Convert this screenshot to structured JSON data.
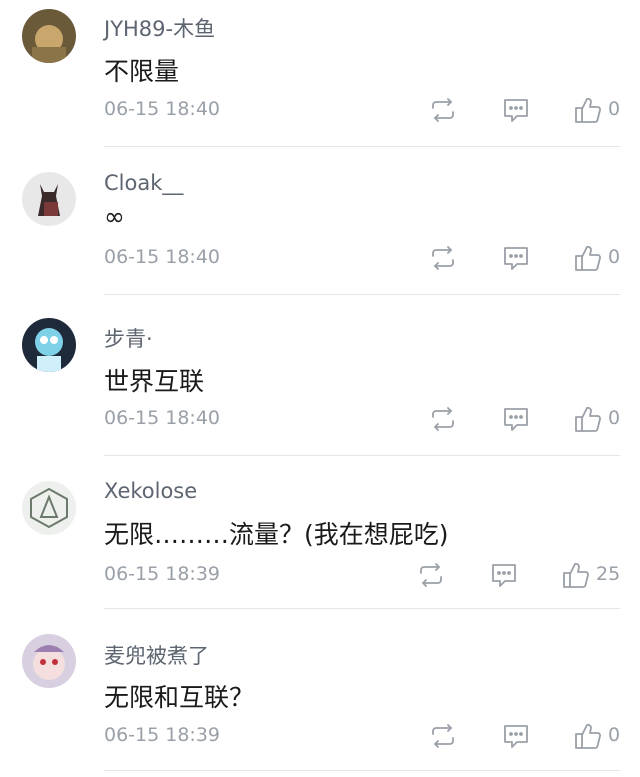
{
  "icons": {
    "share": "share-icon",
    "reply": "comment-icon",
    "like": "thumbs-up-icon"
  },
  "comments": [
    {
      "username": "JYH89-木鱼",
      "content": "不限量",
      "time": "06-15 18:40",
      "likes": "0"
    },
    {
      "username": "Cloak__",
      "content": "∞",
      "time": "06-15 18:40",
      "likes": "0"
    },
    {
      "username": "步青·",
      "content": "世界互联",
      "time": "06-15 18:40",
      "likes": "0"
    },
    {
      "username": "Xekolose",
      "content": "无限………流量？(我在想屁吃)",
      "time": "06-15 18:39",
      "likes": "25"
    },
    {
      "username": "麦兜被煮了",
      "content": "无限和互联？",
      "time": "06-15 18:39",
      "likes": "0"
    }
  ]
}
